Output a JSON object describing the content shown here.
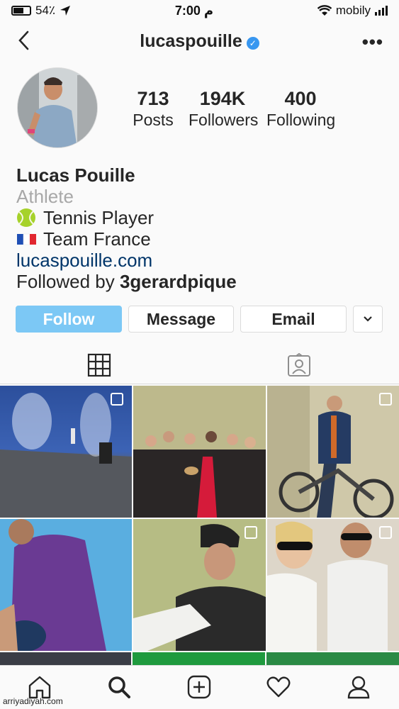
{
  "status_bar": {
    "battery": "54٪",
    "time": "7:00 م",
    "carrier": "mobily"
  },
  "header": {
    "username": "lucaspouille"
  },
  "profile": {
    "stats": [
      {
        "value": "713",
        "label": "Posts"
      },
      {
        "value": "194K",
        "label": "Followers"
      },
      {
        "value": "400",
        "label": "Following"
      }
    ],
    "name": "Lucas Pouille",
    "category": "Athlete",
    "bio_line1": "Tennis Player",
    "bio_line2": "Team France",
    "website": "lucaspouille.com",
    "followed_by_prefix": "Followed by",
    "followed_by_user": "3gerardpique"
  },
  "actions": {
    "follow": "Follow",
    "message": "Message",
    "email": "Email"
  },
  "colors": {
    "follow_button": "#7cc8f5",
    "link": "#003569",
    "verified": "#3897f0"
  },
  "watermark": "arriyadiyah.com"
}
